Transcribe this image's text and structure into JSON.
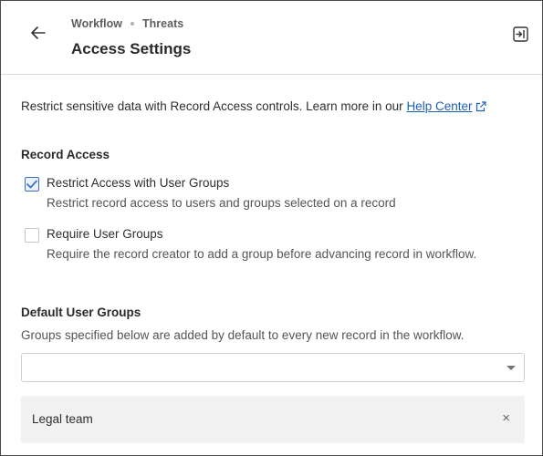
{
  "header": {
    "breadcrumb": [
      "Workflow",
      "Threats"
    ],
    "title": "Access Settings",
    "back_icon": "arrow-left-icon",
    "collapse_icon": "panel-collapse-icon"
  },
  "intro": {
    "text": "Restrict sensitive data with Record Access controls. Learn more in our ",
    "link_label": "Help Center",
    "link_icon": "external-link-icon",
    "link_color": "#1d5fb3"
  },
  "record_access": {
    "title": "Record Access",
    "options": [
      {
        "label": "Restrict Access with User Groups",
        "description": "Restrict record access to users and groups selected on a record",
        "checked": true
      },
      {
        "label": "Require User Groups",
        "description": "Require the record creator to add a group before advancing record in workflow.",
        "checked": false
      }
    ]
  },
  "default_groups": {
    "title": "Default User Groups",
    "description": "Groups specified below are added by default to every new record in the workflow.",
    "select_value": "",
    "selected": [
      {
        "label": "Legal team",
        "remove_glyph": "×"
      }
    ]
  },
  "colors": {
    "accent": "#3a6fc4",
    "chip_bg": "#f1f1f1"
  }
}
